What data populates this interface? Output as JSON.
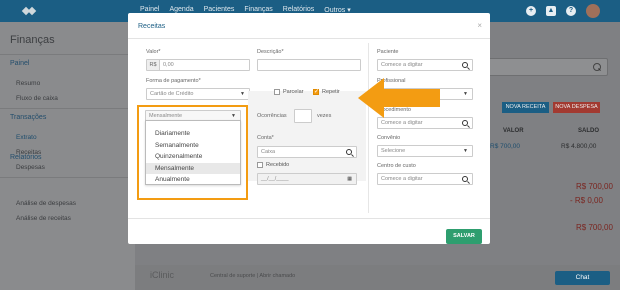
{
  "topbar": {
    "nav": [
      "Painel",
      "Agenda",
      "Pacientes",
      "Finanças",
      "Relatórios",
      "Outros ▾"
    ]
  },
  "sidebar": {
    "title": "Finanças",
    "sections": [
      {
        "label": "Painel",
        "items": [
          "Resumo",
          "Fluxo de caixa"
        ]
      },
      {
        "label": "Transações",
        "items": [
          "Extrato",
          "Receitas",
          "Despesas"
        ]
      },
      {
        "label": "Relatórios",
        "items": [
          "Análise de despesas",
          "Análise de receitas"
        ]
      }
    ]
  },
  "background": {
    "new_income": "NOVA RECEITA",
    "new_expense": "NOVA DESPESA",
    "col_valor": "VALOR",
    "col_saldo": "SALDO",
    "row_valor": "R$ 700,00",
    "row_saldo": "R$ 4.800,00",
    "total1": "R$ 700,00",
    "total2": "- R$ 0,00",
    "total3": "R$ 700,00",
    "footer_logo": "iClinic",
    "footer_links": "Central de suporte  |  Abrir chamado",
    "chat": "Chat",
    "colors": {
      "topbar": "#1b5e84",
      "new_income": "#1b5e84",
      "new_expense": "#c0392b"
    }
  },
  "modal": {
    "title": "Receitas",
    "close": "×",
    "valor_label": "Valor*",
    "valor_prefix": "R$",
    "valor_placeholder": "0,00",
    "descricao_label": "Descrição*",
    "forma_label": "Forma de pagamento*",
    "forma_value": "Cartão de Crédito",
    "parcelar_label": "Parcelar",
    "repetir_label": "Repetir",
    "frequency_value": "Mensalmente",
    "frequency_options": [
      "Diariamente",
      "Semanalmente",
      "Quinzenalmente",
      "Mensalmente",
      "Anualmente"
    ],
    "frequency_selected_index": 3,
    "ocorrencias_label": "Ocorrências",
    "vezes_label": "vezes",
    "conta_label": "Conta*",
    "conta_value": "Caixa",
    "recebido_label": "Recebido",
    "recebido_placeholder": "__/__/____",
    "paciente_label": "Paciente",
    "paciente_placeholder": "Comece a digitar",
    "profissional_label": "Profissional",
    "procedimento_label": "Procedimento",
    "procedimento_placeholder": "Comece a digitar",
    "convenio_label": "Convênio",
    "convenio_value": "Selecione",
    "centro_label": "Centro de custo",
    "centro_placeholder": "Comece a digitar",
    "save_label": "SALVAR",
    "colors": {
      "accent": "#f39c12",
      "save": "#2e9e6f"
    }
  }
}
